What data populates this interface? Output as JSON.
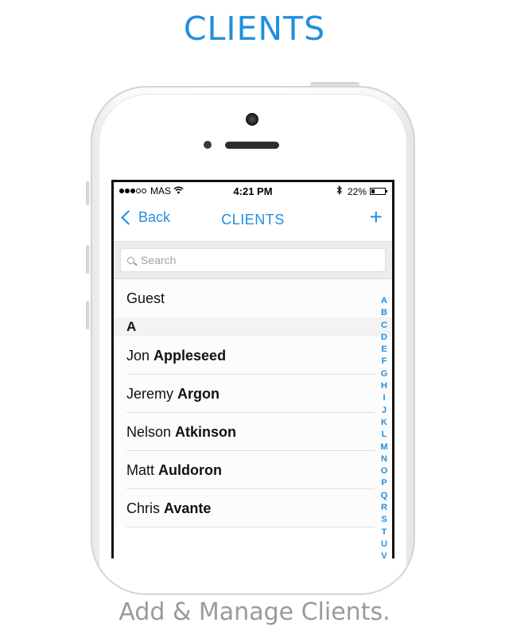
{
  "page": {
    "title": "CLIENTS",
    "tagline": "Add & Manage Clients."
  },
  "status_bar": {
    "carrier": "MAS",
    "time": "4:21 PM",
    "battery": "22%",
    "battery_level": 0.22,
    "signal_bars_filled": 3,
    "signal_bars_total": 5
  },
  "nav": {
    "back_label": "Back",
    "title": "CLIENTS",
    "add_label": "+"
  },
  "search": {
    "placeholder": "Search"
  },
  "list": {
    "guest": "Guest",
    "section_a": "A",
    "clients": [
      {
        "first": "Jon",
        "last": "Appleseed"
      },
      {
        "first": "Jeremy",
        "last": "Argon"
      },
      {
        "first": "Nelson",
        "last": "Atkinson"
      },
      {
        "first": "Matt",
        "last": "Auldoron"
      },
      {
        "first": "Chris",
        "last": "Avante"
      }
    ]
  },
  "index_letters": [
    "A",
    "B",
    "C",
    "D",
    "E",
    "F",
    "G",
    "H",
    "I",
    "J",
    "K",
    "L",
    "M",
    "N",
    "O",
    "P",
    "Q",
    "R",
    "S",
    "T",
    "U",
    "V"
  ],
  "colors": {
    "accent": "#1f8fe0",
    "tagline": "#9a9a9a"
  },
  "icons": [
    "chevron-left-icon",
    "plus-icon",
    "search-icon",
    "wifi-icon",
    "bluetooth-icon",
    "battery-icon",
    "camera-icon"
  ]
}
